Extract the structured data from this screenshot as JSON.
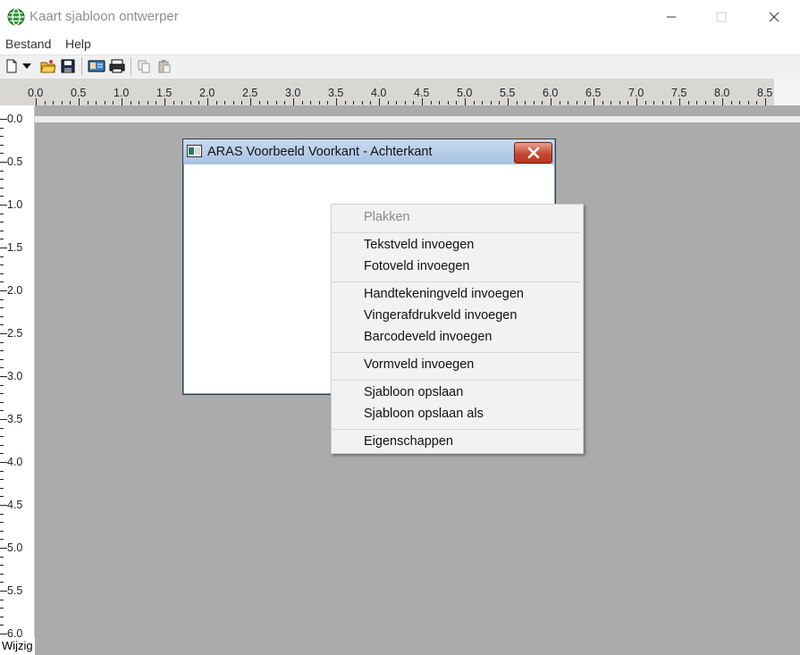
{
  "window": {
    "title": "Kaart sjabloon ontwerper"
  },
  "menubar": {
    "items": [
      {
        "label": "Bestand"
      },
      {
        "label": "Help"
      }
    ]
  },
  "toolbar": {
    "icons": [
      "new-document-icon",
      "dropdown-arrow-icon",
      "open-folder-icon",
      "save-icon",
      "card-preview-icon",
      "print-icon",
      "copy-icon",
      "paste-icon"
    ]
  },
  "ruler": {
    "horizontal": [
      "0.0",
      "0.5",
      "1.0",
      "1.5",
      "2.0",
      "2.5",
      "3.0",
      "3.5",
      "4.0",
      "4.5",
      "5.0",
      "5.5",
      "6.0",
      "6.5",
      "7.0",
      "7.5",
      "8.0",
      "8.5"
    ],
    "vertical": [
      "0.0",
      "0.5",
      "1.0",
      "1.5",
      "2.0",
      "2.5",
      "3.0",
      "3.5",
      "4.0",
      "4.5",
      "5.0",
      "5.5",
      "6.0"
    ]
  },
  "child_window": {
    "title": "ARAS Voorbeeld Voorkant - Achterkant"
  },
  "context_menu": {
    "groups": [
      [
        {
          "label": "Plakken",
          "enabled": false
        }
      ],
      [
        {
          "label": "Tekstveld invoegen"
        },
        {
          "label": "Fotoveld invoegen"
        }
      ],
      [
        {
          "label": "Handtekeningveld invoegen"
        },
        {
          "label": "Vingerafdrukveld invoegen"
        },
        {
          "label": "Barcodeveld invoegen"
        }
      ],
      [
        {
          "label": "Vormveld invoegen"
        }
      ],
      [
        {
          "label": "Sjabloon opslaan"
        },
        {
          "label": "Sjabloon opslaan als"
        }
      ],
      [
        {
          "label": "Eigenschappen"
        }
      ]
    ]
  },
  "status": {
    "text": "Wijzig"
  },
  "colors": {
    "canvas": "#ababab",
    "ruler": "#d9d7d3",
    "close_button": "#c44a33",
    "menu": "#f2f2f2"
  }
}
